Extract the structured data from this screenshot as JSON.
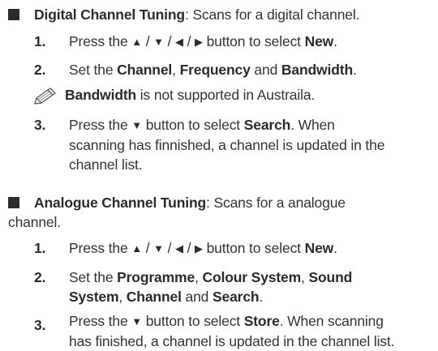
{
  "digital": {
    "title": "Digital Channel Tuning",
    "desc": ": Scans for a digital channel.",
    "step1": {
      "num": "1.",
      "pre": "Press the ",
      "arrows": [
        "▲",
        "▼",
        "◀",
        "▶"
      ],
      "sep": " / ",
      "mid": " button to select ",
      "target": "New",
      "post": "."
    },
    "step2": {
      "num": "2.",
      "pre": "Set the ",
      "b1": "Channel",
      "c1": ", ",
      "b2": "Frequency",
      "c2": " and ",
      "b3": "Bandwidth",
      "post": "."
    },
    "note": {
      "icon": "note-pencil-icon",
      "bold": "Bandwidth",
      "rest": " is not supported in Austraila."
    },
    "step3": {
      "num": "3.",
      "pre": "Press the ",
      "arrow": "▼",
      "mid": " button to select ",
      "target": "Search",
      "line1_rest": ". When",
      "line2": "scanning has finnished, a channel is updated in the",
      "line3": "channel list."
    }
  },
  "analogue": {
    "title": "Analogue Channel Tuning",
    "desc_line1": ": Scans for a analogue",
    "desc_line2": "channel.",
    "step1": {
      "num": "1.",
      "pre": "Press the ",
      "arrows": [
        "▲",
        "▼",
        "◀",
        "▶"
      ],
      "sep": " / ",
      "mid": " button to select ",
      "target": "New",
      "post": "."
    },
    "step2": {
      "num": "2.",
      "pre": "Set the ",
      "b1": "Programme",
      "c1": ", ",
      "b2": "Colour System",
      "c2": ", ",
      "b3a": "Sound",
      "b3b": "System",
      "c3": ", ",
      "b4": "Channel",
      "c4": " and ",
      "b5": "Search",
      "post": "."
    },
    "step3": {
      "num": "3.",
      "pre": "Press the ",
      "arrow": "▼",
      "mid": " button to select ",
      "target": "Store",
      "line1_rest": ". When scanning",
      "line2": "has finished, a channel is updated in the channel list."
    }
  }
}
